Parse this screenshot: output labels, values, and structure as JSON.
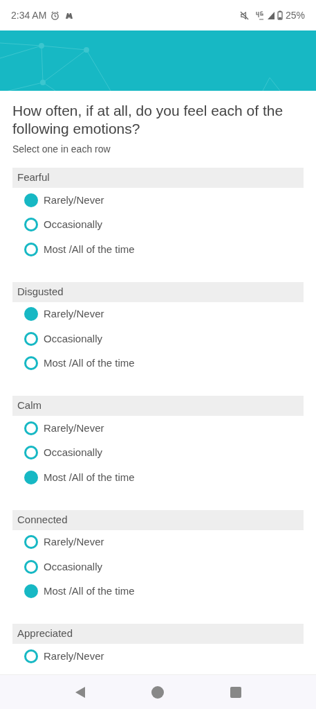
{
  "status_bar": {
    "time": "2:34 AM",
    "battery": "25%"
  },
  "question": {
    "title": "How often, if at all, do you feel each of the following emotions?",
    "instruction": "Select one in each row"
  },
  "rows": [
    {
      "label": "Fearful",
      "options": [
        {
          "label": "Rarely/Never",
          "selected": true
        },
        {
          "label": "Occasionally",
          "selected": false
        },
        {
          "label": "Most /All of the time",
          "selected": false
        }
      ]
    },
    {
      "label": "Disgusted",
      "options": [
        {
          "label": "Rarely/Never",
          "selected": true
        },
        {
          "label": "Occasionally",
          "selected": false
        },
        {
          "label": "Most /All of the time",
          "selected": false
        }
      ]
    },
    {
      "label": "Calm",
      "options": [
        {
          "label": "Rarely/Never",
          "selected": false
        },
        {
          "label": "Occasionally",
          "selected": false
        },
        {
          "label": "Most /All of the time",
          "selected": true
        }
      ]
    },
    {
      "label": "Connected",
      "options": [
        {
          "label": "Rarely/Never",
          "selected": false
        },
        {
          "label": "Occasionally",
          "selected": false
        },
        {
          "label": "Most /All of the time",
          "selected": true
        }
      ]
    },
    {
      "label": "Appreciated",
      "options": [
        {
          "label": "Rarely/Never",
          "selected": false
        }
      ]
    }
  ]
}
